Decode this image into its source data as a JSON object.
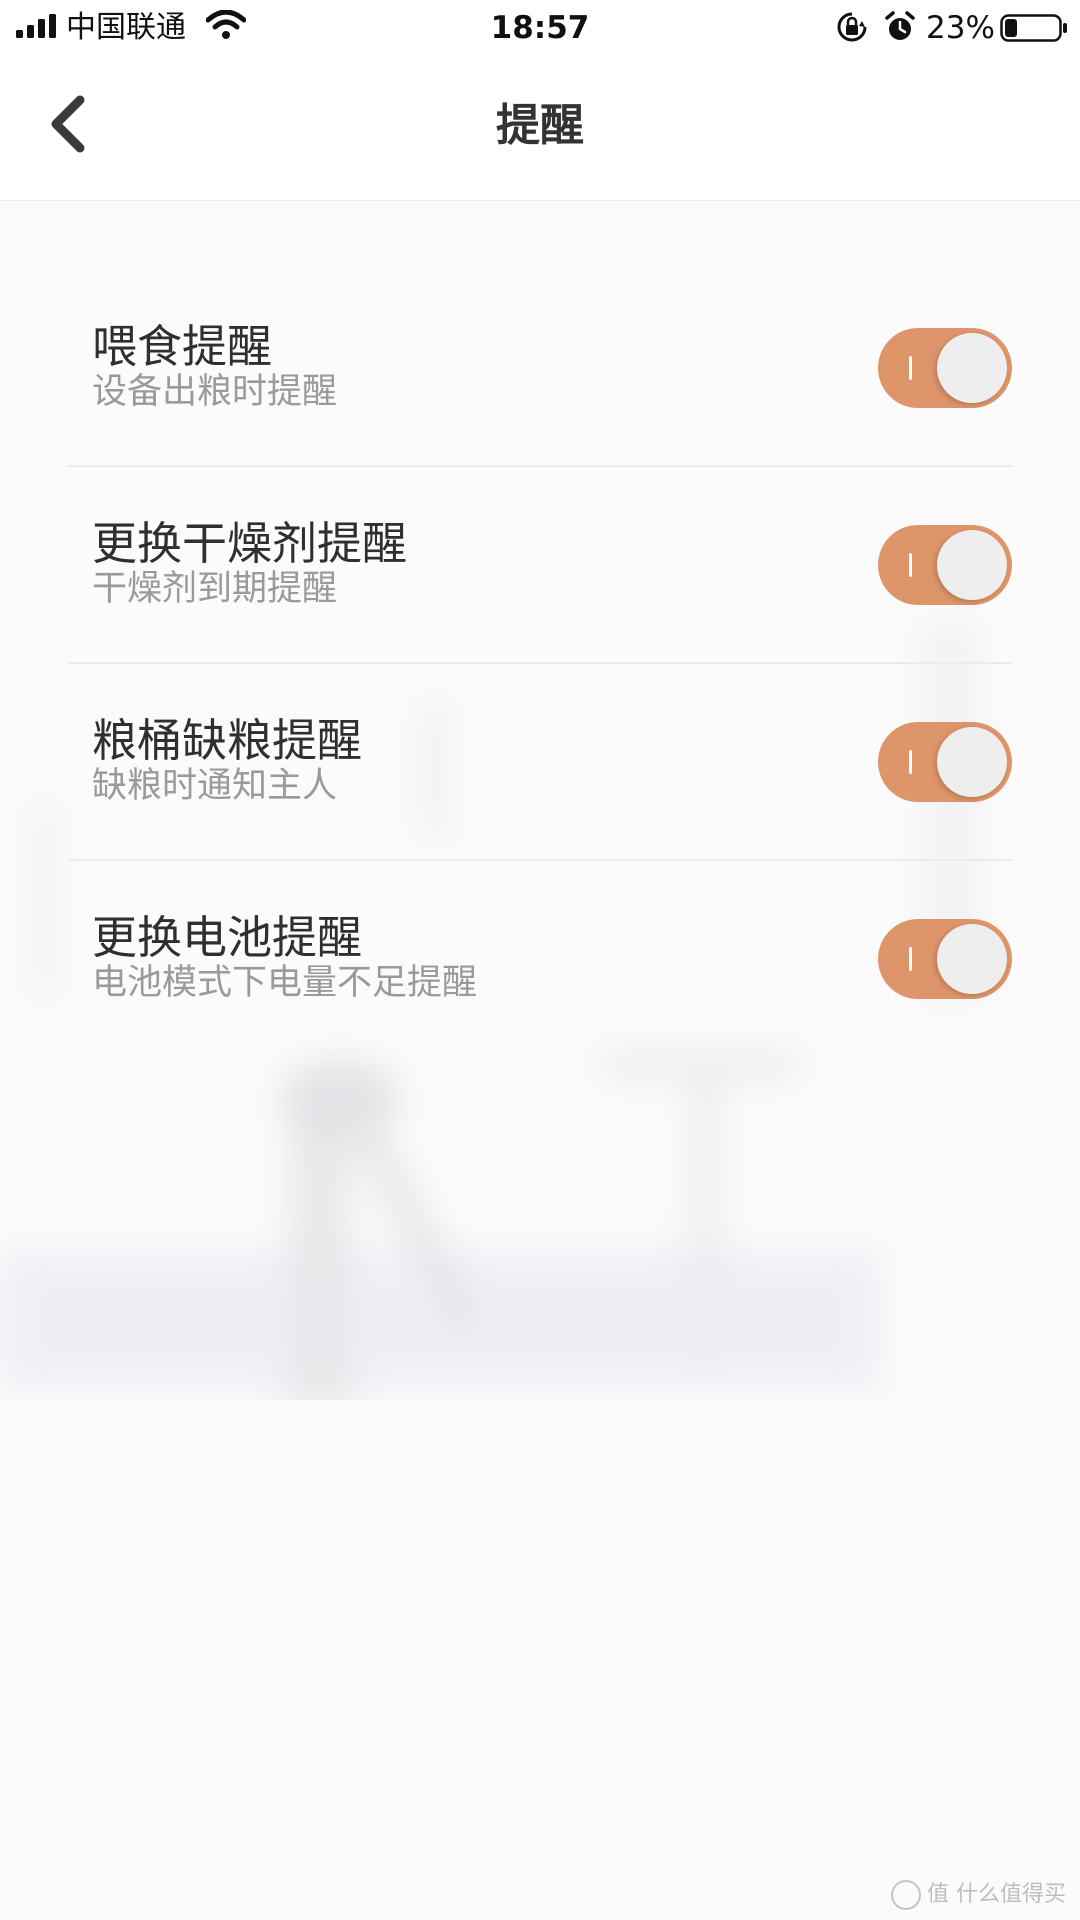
{
  "status_bar": {
    "carrier": "中国联通",
    "time": "18:57",
    "battery_percent": "23%",
    "battery_level": 0.23,
    "icons": [
      "signal-icon",
      "wifi-icon",
      "orientation-lock-icon",
      "alarm-icon",
      "battery-icon"
    ]
  },
  "nav": {
    "title": "提醒",
    "back_icon": "chevron-left-icon"
  },
  "reminders": [
    {
      "title": "喂食提醒",
      "subtitle": "设备出粮时提醒",
      "enabled": true
    },
    {
      "title": "更换干燥剂提醒",
      "subtitle": "干燥剂到期提醒",
      "enabled": true
    },
    {
      "title": "粮桶缺粮提醒",
      "subtitle": "缺粮时通知主人",
      "enabled": true
    },
    {
      "title": "更换电池提醒",
      "subtitle": "电池模式下电量不足提醒",
      "enabled": true
    }
  ],
  "colors": {
    "toggle_on": "#df956a",
    "title_text": "#2f2f2f",
    "subtitle_text": "#9a9a9a"
  },
  "watermark": {
    "text": "值 什么值得买"
  }
}
